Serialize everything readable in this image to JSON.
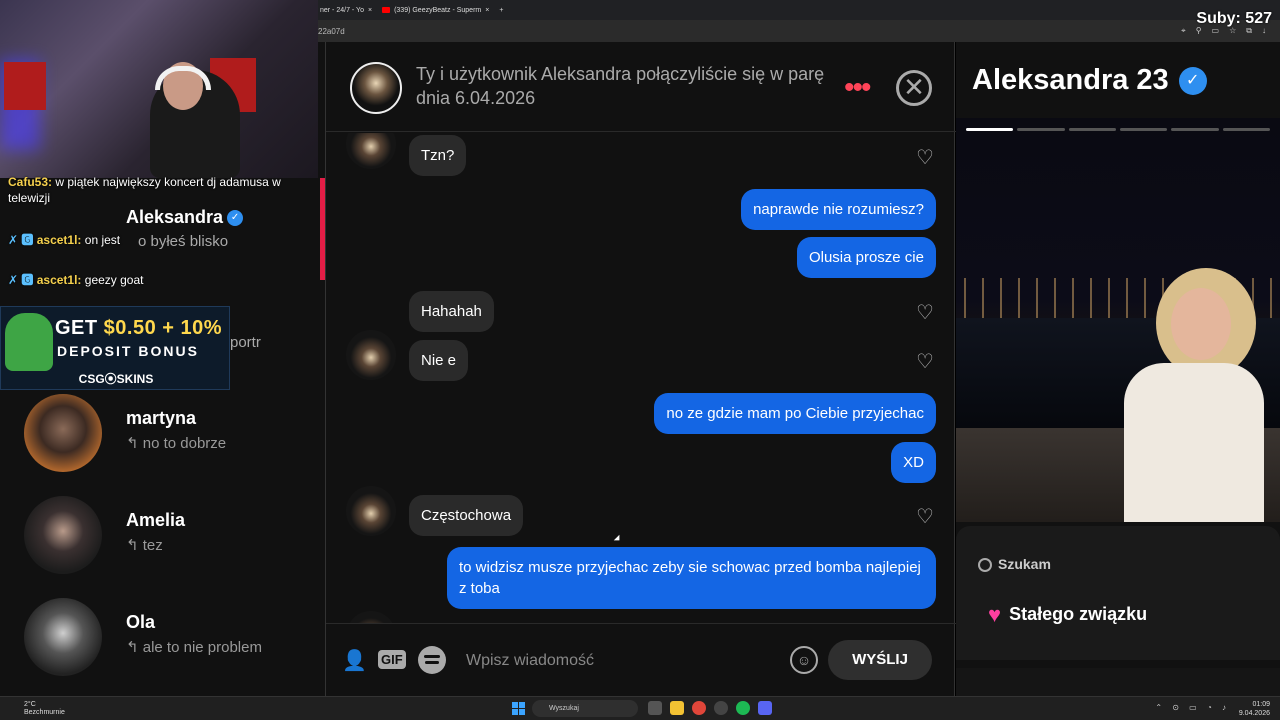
{
  "browser": {
    "tabs": [
      "ner - 24/7 - Yo",
      "(339) GeezyBeatz - Superm"
    ],
    "address_fragment": "22a07d"
  },
  "stream": {
    "subs_label": "Suby: 527",
    "chat": [
      {
        "user": "Cafu53:",
        "text": "w piątek największy koncert dj adamusa w telewizji"
      },
      {
        "user": "ascet1l:",
        "text": "on jest",
        "badge": "✗ 🅶"
      },
      {
        "user": "ascet1l:",
        "text": "geezy goat",
        "badge": "✗ 🅶"
      }
    ],
    "ad": {
      "line1_a": "GET ",
      "line1_b": "$0.50 + 10%",
      "line2": "DEPOSIT BONUS",
      "brand": "CSG⦿SKINS"
    }
  },
  "matches": {
    "partial_name": "Aleksandra",
    "partial_preview": "o byłeś blisko",
    "partial_preview2": "portr",
    "items": [
      {
        "name": "martyna",
        "preview": "↰ no to dobrze"
      },
      {
        "name": "Amelia",
        "preview": "↰ tez"
      },
      {
        "name": "Ola",
        "preview": "↰ ale to nie problem"
      }
    ]
  },
  "chat": {
    "header_text": "Ty i użytkownik Aleksandra połączyliście się w parę dnia 6.04.2026",
    "messages": [
      {
        "dir": "in",
        "text": "Tzn?"
      },
      {
        "dir": "out",
        "text": "naprawde nie rozumiesz?"
      },
      {
        "dir": "out",
        "text": "Olusia prosze cie"
      },
      {
        "dir": "in",
        "text": "Hahahah"
      },
      {
        "dir": "in",
        "text": "Nie e"
      },
      {
        "dir": "out",
        "text": "no ze gdzie mam po Ciebie przyjechac"
      },
      {
        "dir": "out",
        "text": "XD"
      },
      {
        "dir": "in",
        "text": "Częstochowa"
      },
      {
        "dir": "out",
        "text": "to widzisz musze przyjechac zeby sie schowac przed bomba najlepiej z toba"
      }
    ],
    "composer": {
      "placeholder": "Wpisz wiadomość",
      "gif_label": "GIF",
      "send_label": "WYŚLIJ"
    }
  },
  "profile": {
    "name_age": "Aleksandra 23",
    "seeking_label": "Szukam",
    "relationship": "Stałego związku",
    "photo_count": 6,
    "photo_index": 1
  },
  "taskbar": {
    "weather_temp": "2°C",
    "weather_desc": "Bezchmurnie",
    "search_label": "Wyszukaj",
    "time": "01:09",
    "date": "9.04.2026"
  },
  "colors": {
    "outgoing_bubble": "#1466e4",
    "incoming_bubble": "#2a2a2a",
    "accent": "#ff4458",
    "verified": "#2e8ff0"
  }
}
